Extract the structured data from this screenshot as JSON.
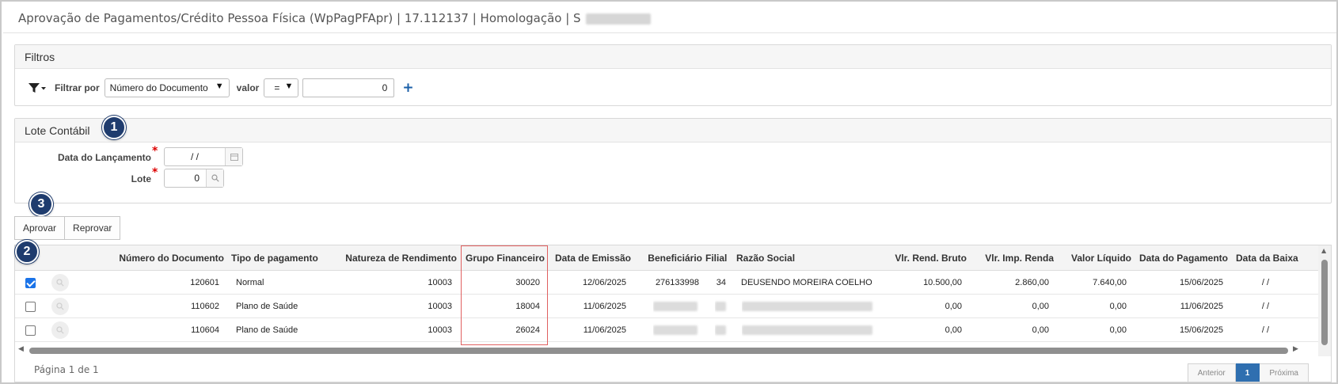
{
  "window": {
    "title": "Aprovação de Pagamentos/Crédito Pessoa Física (WpPagPFApr) | 17.112137 | Homologação | S"
  },
  "filters": {
    "section_title": "Filtros",
    "filter_label": "Filtrar por",
    "filter_field": "Número do Documento",
    "value_label": "valor",
    "operator": "=",
    "value": "0",
    "add_symbol": "+"
  },
  "lote": {
    "section_title": "Lote Contábil",
    "date_label": "Data do Lançamento",
    "date_value": " / /",
    "lote_label": "Lote",
    "lote_value": "0",
    "required_mark": "*"
  },
  "badges": {
    "one": "1",
    "two": "2",
    "three": "3"
  },
  "actions": {
    "approve": "Aprovar",
    "reject": "Reprovar"
  },
  "grid": {
    "columns": [
      "Número do Documento",
      "Tipo de pagamento",
      "Natureza de Rendimento",
      "Grupo Financeiro",
      "Data de Emissão",
      "Beneficiário",
      "Filial",
      "Razão Social",
      "Vlr. Rend. Bruto",
      "Vlr. Imp. Renda",
      "Valor Líquido",
      "Data do Pagamento",
      "Data da Baixa"
    ],
    "rows": [
      {
        "checked": true,
        "doc": "120601",
        "tipo": "Normal",
        "natureza": "10003",
        "grupo": "30020",
        "emissao": "12/06/2025",
        "beneficiario": "276133998",
        "filial": "34",
        "razao": "DEUSENDO MOREIRA COELHO",
        "bruto": "10.500,00",
        "imposto": "2.860,00",
        "liquido": "7.640,00",
        "pagamento": "15/06/2025",
        "baixa": "/ /"
      },
      {
        "checked": false,
        "doc": "110602",
        "tipo": "Plano de Saúde",
        "natureza": "10003",
        "grupo": "18004",
        "emissao": "11/06/2025",
        "beneficiario": "",
        "filial": "",
        "razao": "",
        "bruto": "0,00",
        "imposto": "0,00",
        "liquido": "0,00",
        "pagamento": "11/06/2025",
        "baixa": "/ /"
      },
      {
        "checked": false,
        "doc": "110604",
        "tipo": "Plano de Saúde",
        "natureza": "10003",
        "grupo": "26024",
        "emissao": "11/06/2025",
        "beneficiario": "",
        "filial": "",
        "razao": "",
        "bruto": "0,00",
        "imposto": "0,00",
        "liquido": "0,00",
        "pagamento": "15/06/2025",
        "baixa": "/ /"
      }
    ],
    "page_info": "Página 1 de 1",
    "pager": {
      "prev": "Anterior",
      "current": "1",
      "next": "Próxima"
    }
  },
  "colors": {
    "badge": "#1f3c6e",
    "highlight": "#e06060",
    "pager_active": "#2f6fb0",
    "checkbox": "#1a73e8"
  },
  "icons": {
    "filter": "funnel-icon",
    "calendar": "calendar-icon",
    "search": "magnifier-icon"
  }
}
